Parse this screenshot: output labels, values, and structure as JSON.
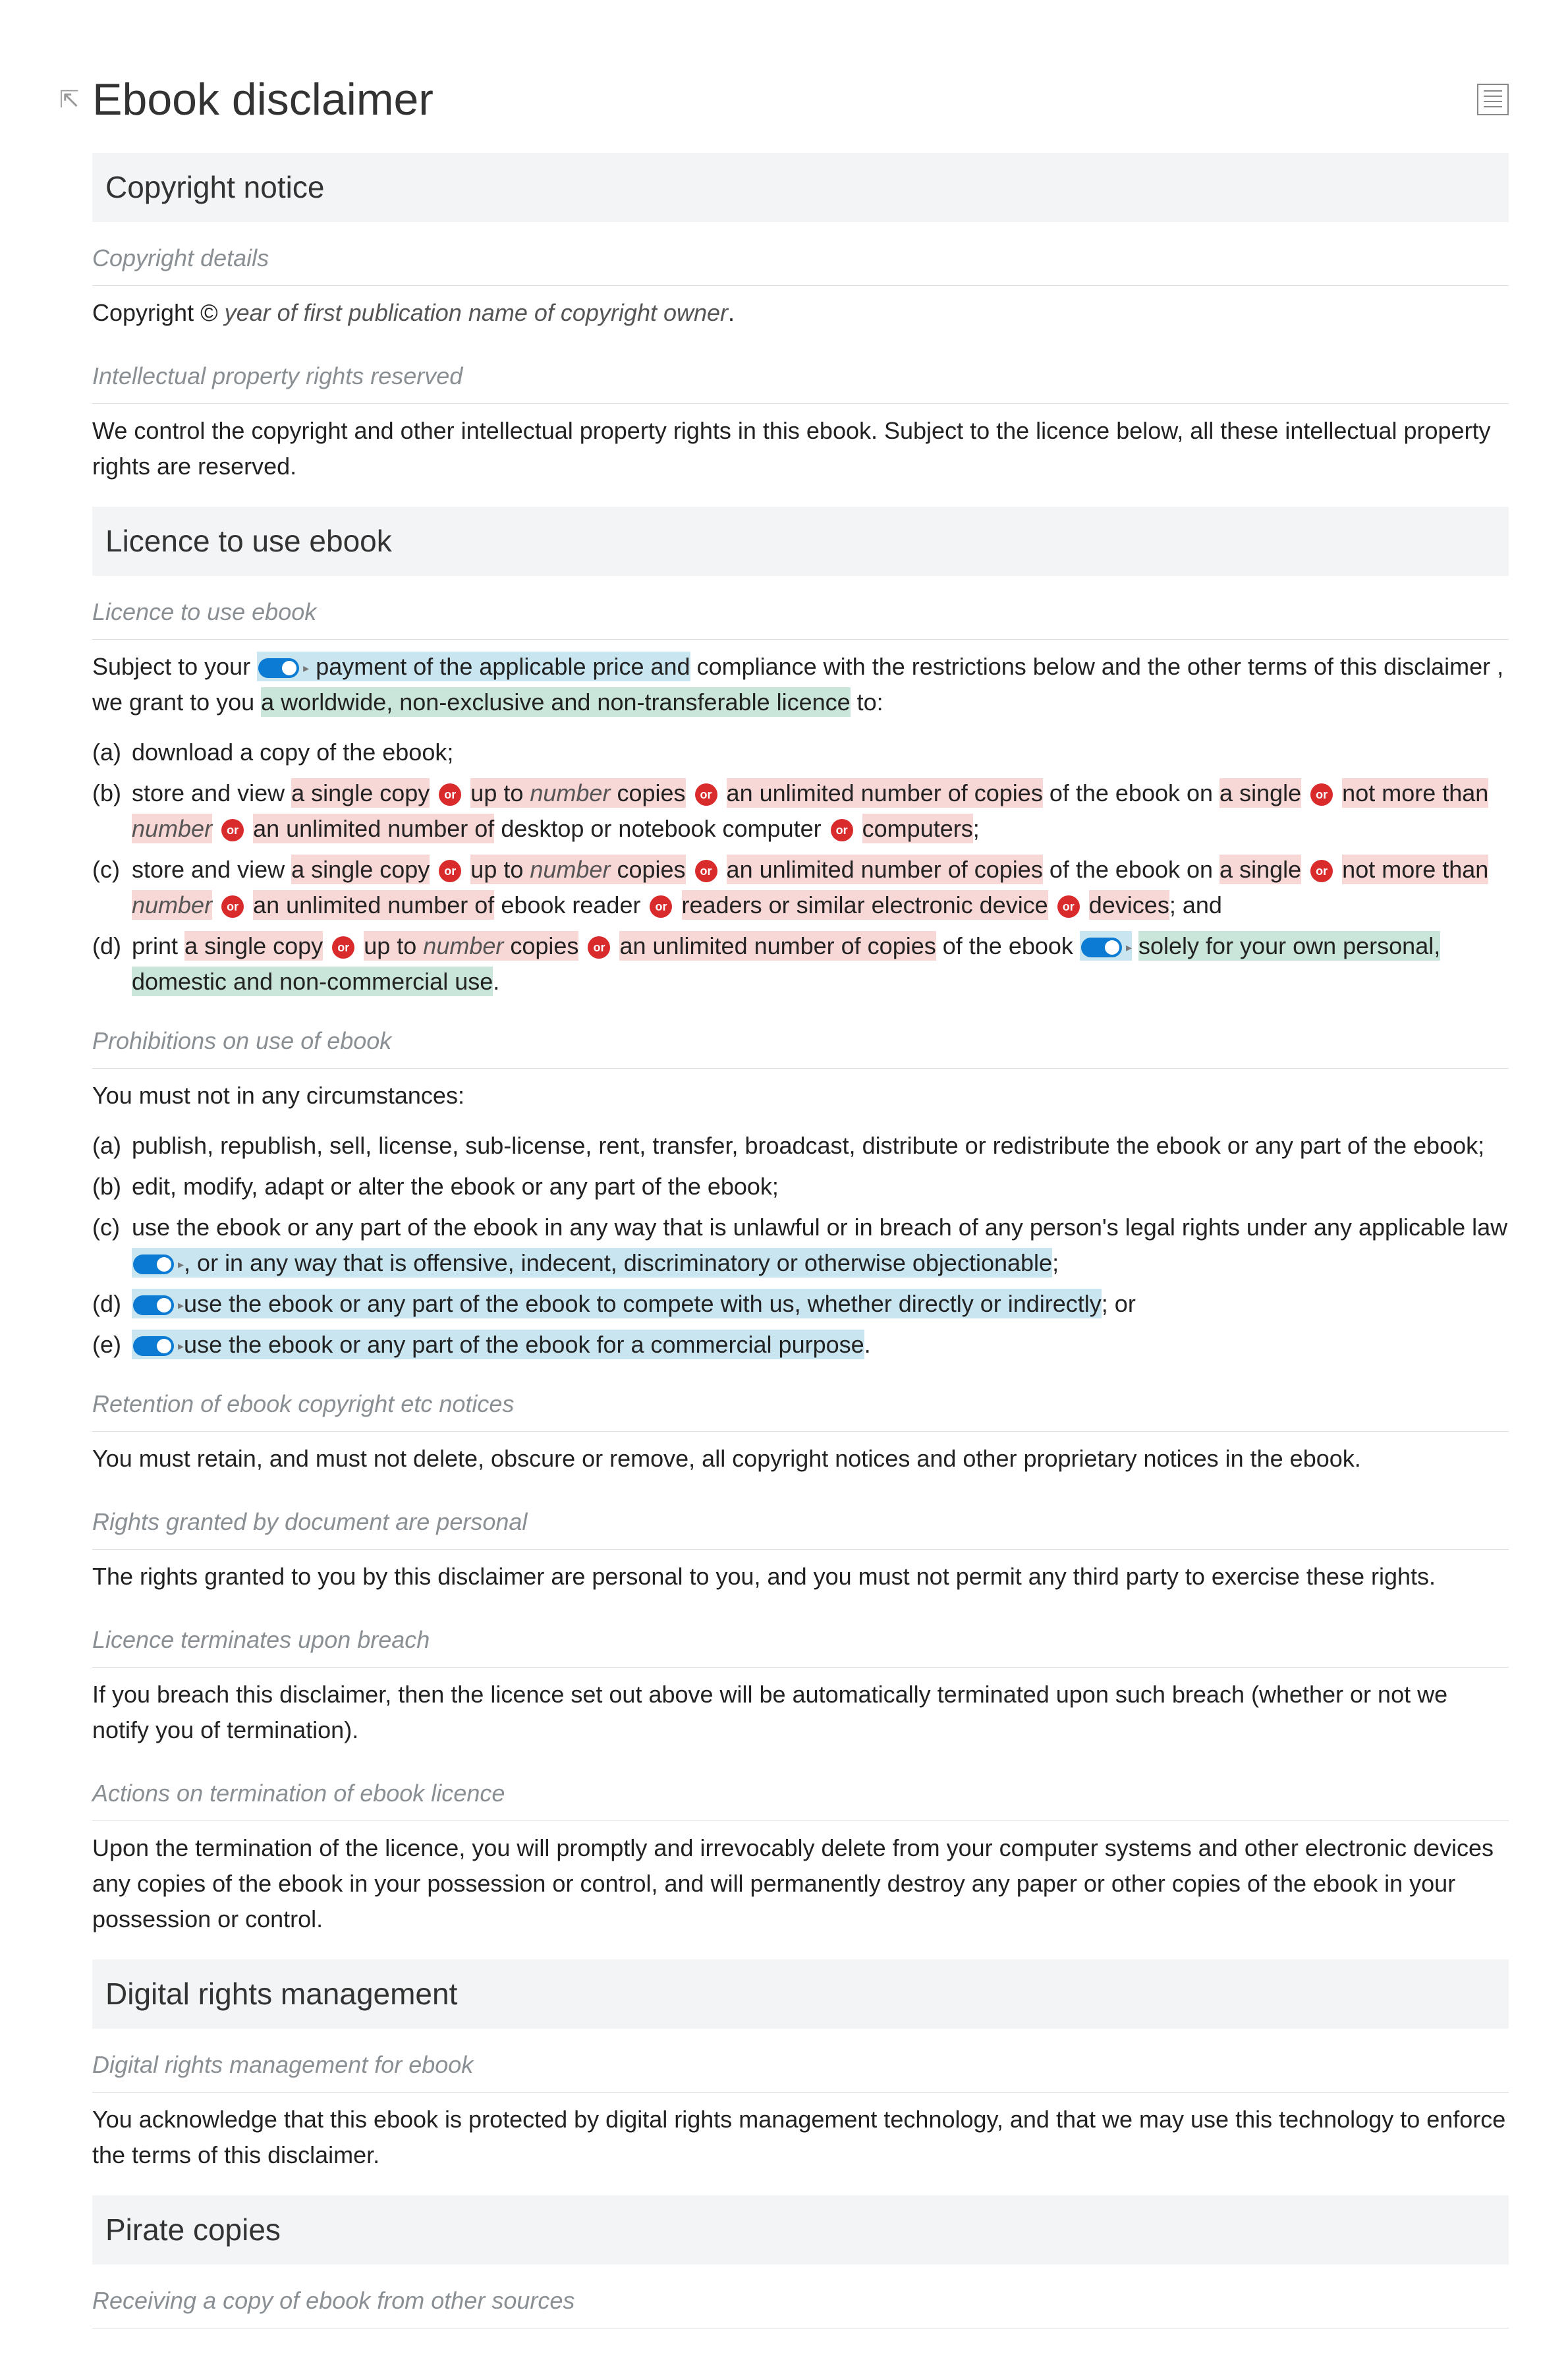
{
  "title": "Ebook disclaimer",
  "or_label": "or",
  "sections": {
    "copyright": {
      "header": "Copyright notice",
      "details": {
        "label": "Copyright details",
        "prefix": "Copyright © ",
        "year_ph": "year of first publication",
        "owner_ph": "name of copyright owner",
        "suffix": "."
      },
      "ip": {
        "label": "Intellectual property rights reserved",
        "text": "We control the copyright and other intellectual property rights in this ebook. Subject to the licence below, all these intellectual property rights are reserved."
      }
    },
    "licence": {
      "header": "Licence to use ebook",
      "use": {
        "label": "Licence to use ebook",
        "intro_1": "Subject to your ",
        "intro_blue": "payment of the applicable price and",
        "intro_2": " compliance with the restrictions below and the other terms of this disclaimer , we grant to you ",
        "intro_green": "a worldwide, non-exclusive and non-transferable licence",
        "intro_3": " to:",
        "a": "download a copy of the ebook;",
        "bc": {
          "p1": "store and view ",
          "p2": "a single copy",
          "p3": "up to ",
          "num": "number",
          "p4": " copies",
          "p5": "an unlimited number of copies",
          "p6": " of the ebook on ",
          "p7": "a single",
          "p8": "not more than ",
          "p9": "an unlimited number of",
          "b_end1": " desktop or notebook computer",
          "b_end2": "computers",
          "b_suffix": ";",
          "c_end1": " ebook reader",
          "c_end2": "readers or similar electronic device",
          "c_end3": "devices",
          "c_suffix": "; and"
        },
        "d": {
          "p1": "print ",
          "p2": "a single copy",
          "p3": "up to ",
          "num": "number",
          "p4": " copies",
          "p5": "an unlimited number of copies",
          "p6": " of the ebook",
          "green": "solely for your own personal, domestic and non-commercial use",
          "suffix": "."
        }
      },
      "prohibitions": {
        "label": "Prohibitions on use of ebook",
        "intro": "You must not in any circumstances:",
        "a": "publish, republish, sell, license, sub-license, rent, transfer, broadcast, distribute or redistribute the ebook or any part of the ebook;",
        "b": "edit, modify, adapt or alter the ebook or any part of the ebook;",
        "c_1": "use the ebook or any part of the ebook in any way that is unlawful or in breach of any person's legal rights under any applicable law",
        "c_blue": ", or in any way that is offensive, indecent, discriminatory or otherwise objectionable",
        "c_suffix": ";",
        "d_blue": "use the ebook or any part of the ebook to compete with us, whether directly or indirectly",
        "d_suffix": "; or",
        "e_blue": "use the ebook or any part of the ebook for a commercial purpose",
        "e_suffix": "."
      },
      "retention": {
        "label": "Retention of ebook copyright etc notices",
        "text": "You must retain, and must not delete, obscure or remove, all copyright notices and other proprietary notices in the ebook."
      },
      "rights": {
        "label": "Rights granted by document are personal",
        "text": "The rights granted to you by this disclaimer are personal to you, and you must not permit any third party to exercise these rights."
      },
      "terminate": {
        "label": "Licence terminates upon breach",
        "text": "If you breach this disclaimer, then the licence set out above will be automatically terminated upon such breach (whether or not we notify you of termination)."
      },
      "actions": {
        "label": "Actions on termination of ebook licence",
        "text": "Upon the termination of the licence, you will promptly and irrevocably delete from your computer systems and other electronic devices any copies of the ebook in your possession or control, and will permanently destroy any paper or other copies of the ebook in your possession or control."
      }
    },
    "drm": {
      "header": "Digital rights management",
      "sub": {
        "label": "Digital rights management for ebook",
        "text": "You acknowledge that this ebook is protected by digital rights management technology, and that we may use this technology to enforce the terms of this disclaimer."
      }
    },
    "pirate": {
      "header": "Pirate copies",
      "sub": {
        "label": "Receiving a copy of ebook from other sources"
      }
    }
  }
}
